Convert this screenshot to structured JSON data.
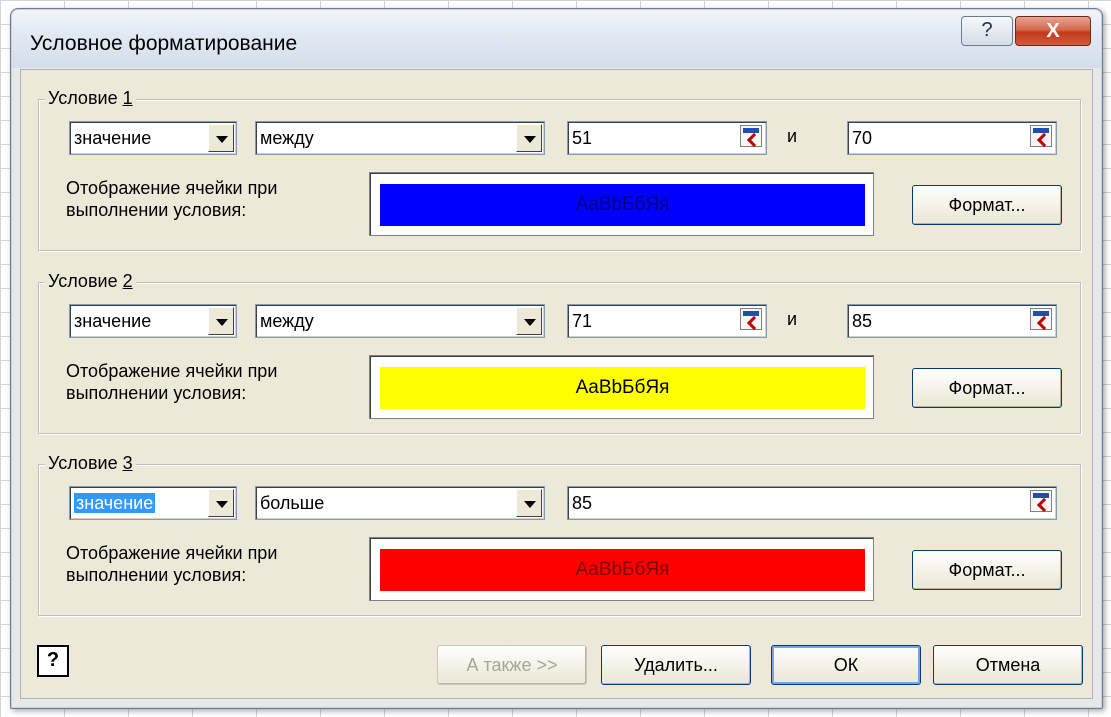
{
  "window": {
    "title": "Условное форматирование",
    "help_glyph": "?",
    "close_glyph": "X"
  },
  "conditions": [
    {
      "legend_prefix": "Условие ",
      "legend_number": "1",
      "type": "значение",
      "operator": "между",
      "value1": "51",
      "and_label": "и",
      "value2": "70",
      "preview_label": "Отображение ячейки при выполнении условия:",
      "preview_text": "AaBbБбЯя",
      "preview_bg": "#0000ff",
      "preview_fg": "#000080",
      "format_button": "Формат..."
    },
    {
      "legend_prefix": "Условие ",
      "legend_number": "2",
      "type": "значение",
      "operator": "между",
      "value1": "71",
      "and_label": "и",
      "value2": "85",
      "preview_label": "Отображение ячейки при выполнении условия:",
      "preview_text": "AaBbБбЯя",
      "preview_bg": "#ffff00",
      "preview_fg": "#000000",
      "format_button": "Формат..."
    },
    {
      "legend_prefix": "Условие ",
      "legend_number": "3",
      "type": "значение",
      "operator": "больше",
      "value1": "85",
      "preview_label": "Отображение ячейки при выполнении условия:",
      "preview_text": "AaBbБбЯя",
      "preview_bg": "#ff0000",
      "preview_fg": "#800000",
      "format_button": "Формат..."
    }
  ],
  "footer": {
    "help_icon": "?",
    "also_button": "А также >>",
    "delete_button": "Удалить...",
    "ok_button": "ОК",
    "cancel_button": "Отмена"
  }
}
